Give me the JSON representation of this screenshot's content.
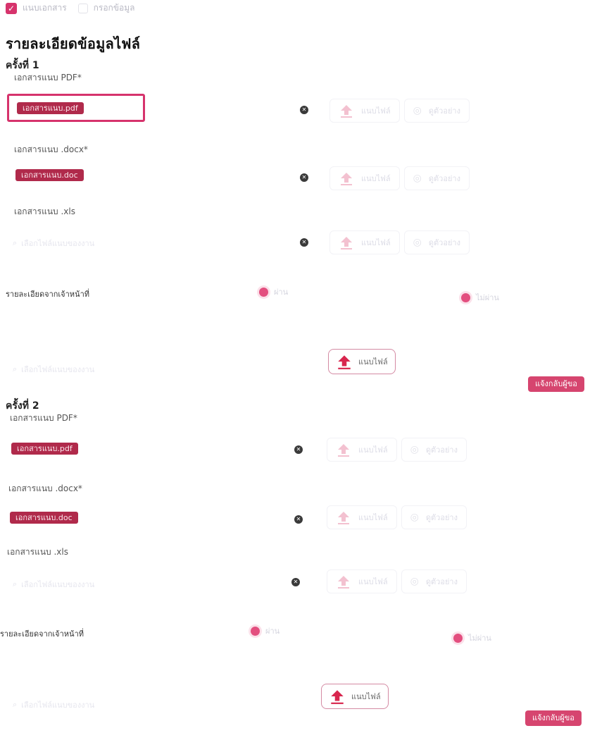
{
  "tabs": [
    {
      "label": "แนบเอกสาร"
    },
    {
      "label": "กรอกข้อมูล"
    }
  ],
  "page_title": "รายละเอียดข้อมูลไฟล์",
  "rounds": [
    {
      "title": "ครั้งที่ 1",
      "fields": [
        {
          "label": "เอกสารแนบ PDF*",
          "file": "เอกสารแนบ.pdf",
          "upload_label": "แนบไฟล์",
          "view_label": "ดูตัวอย่าง"
        },
        {
          "label": "เอกสารแนบ .docx*",
          "file": "เอกสารแนบ.doc",
          "upload_label": "แนบไฟล์",
          "view_label": "ดูตัวอย่าง"
        },
        {
          "label": "เอกสารแนบ .xls",
          "placeholder": "เลือกไฟล์แนบของงาน",
          "upload_label": "แนบไฟล์",
          "view_label": "ดูตัวอย่าง"
        }
      ],
      "officer_label": "รายละเอียดจากเจ้าหน้าที่",
      "radio_pass": "ผ่าน",
      "radio_fail": "ไม่ผ่าน",
      "officer_placeholder": "เลือกไฟล์แนบของงาน",
      "upload_label": "แนบไฟล์",
      "notify_label": "แจ้งกลับผู้ขอ"
    },
    {
      "title": "ครั้งที่ 2",
      "fields": [
        {
          "label": "เอกสารแนบ PDF*",
          "file": "เอกสารแนบ.pdf",
          "upload_label": "แนบไฟล์",
          "view_label": "ดูตัวอย่าง"
        },
        {
          "label": "เอกสารแนบ .docx*",
          "file": "เอกสารแนบ.doc",
          "upload_label": "แนบไฟล์",
          "view_label": "ดูตัวอย่าง"
        },
        {
          "label": "เอกสารแนบ .xls",
          "placeholder": "เลือกไฟล์แนบของงาน",
          "upload_label": "แนบไฟล์",
          "view_label": "ดูตัวอย่าง"
        }
      ],
      "officer_label": "รายละเอียดจากเจ้าหน้าที่",
      "radio_pass": "ผ่าน",
      "radio_fail": "ไม่ผ่าน",
      "officer_placeholder": "เลือกไฟล์แนบของงาน",
      "upload_label": "แนบไฟล์",
      "notify_label": "แจ้งกลับผู้ขอ"
    }
  ],
  "colors": {
    "accent": "#d6336c",
    "tag": "#b02a4b"
  },
  "icons": [
    "checkbox-checked-icon",
    "delete-icon",
    "upload-icon",
    "eye-icon",
    "paperclip-icon"
  ]
}
